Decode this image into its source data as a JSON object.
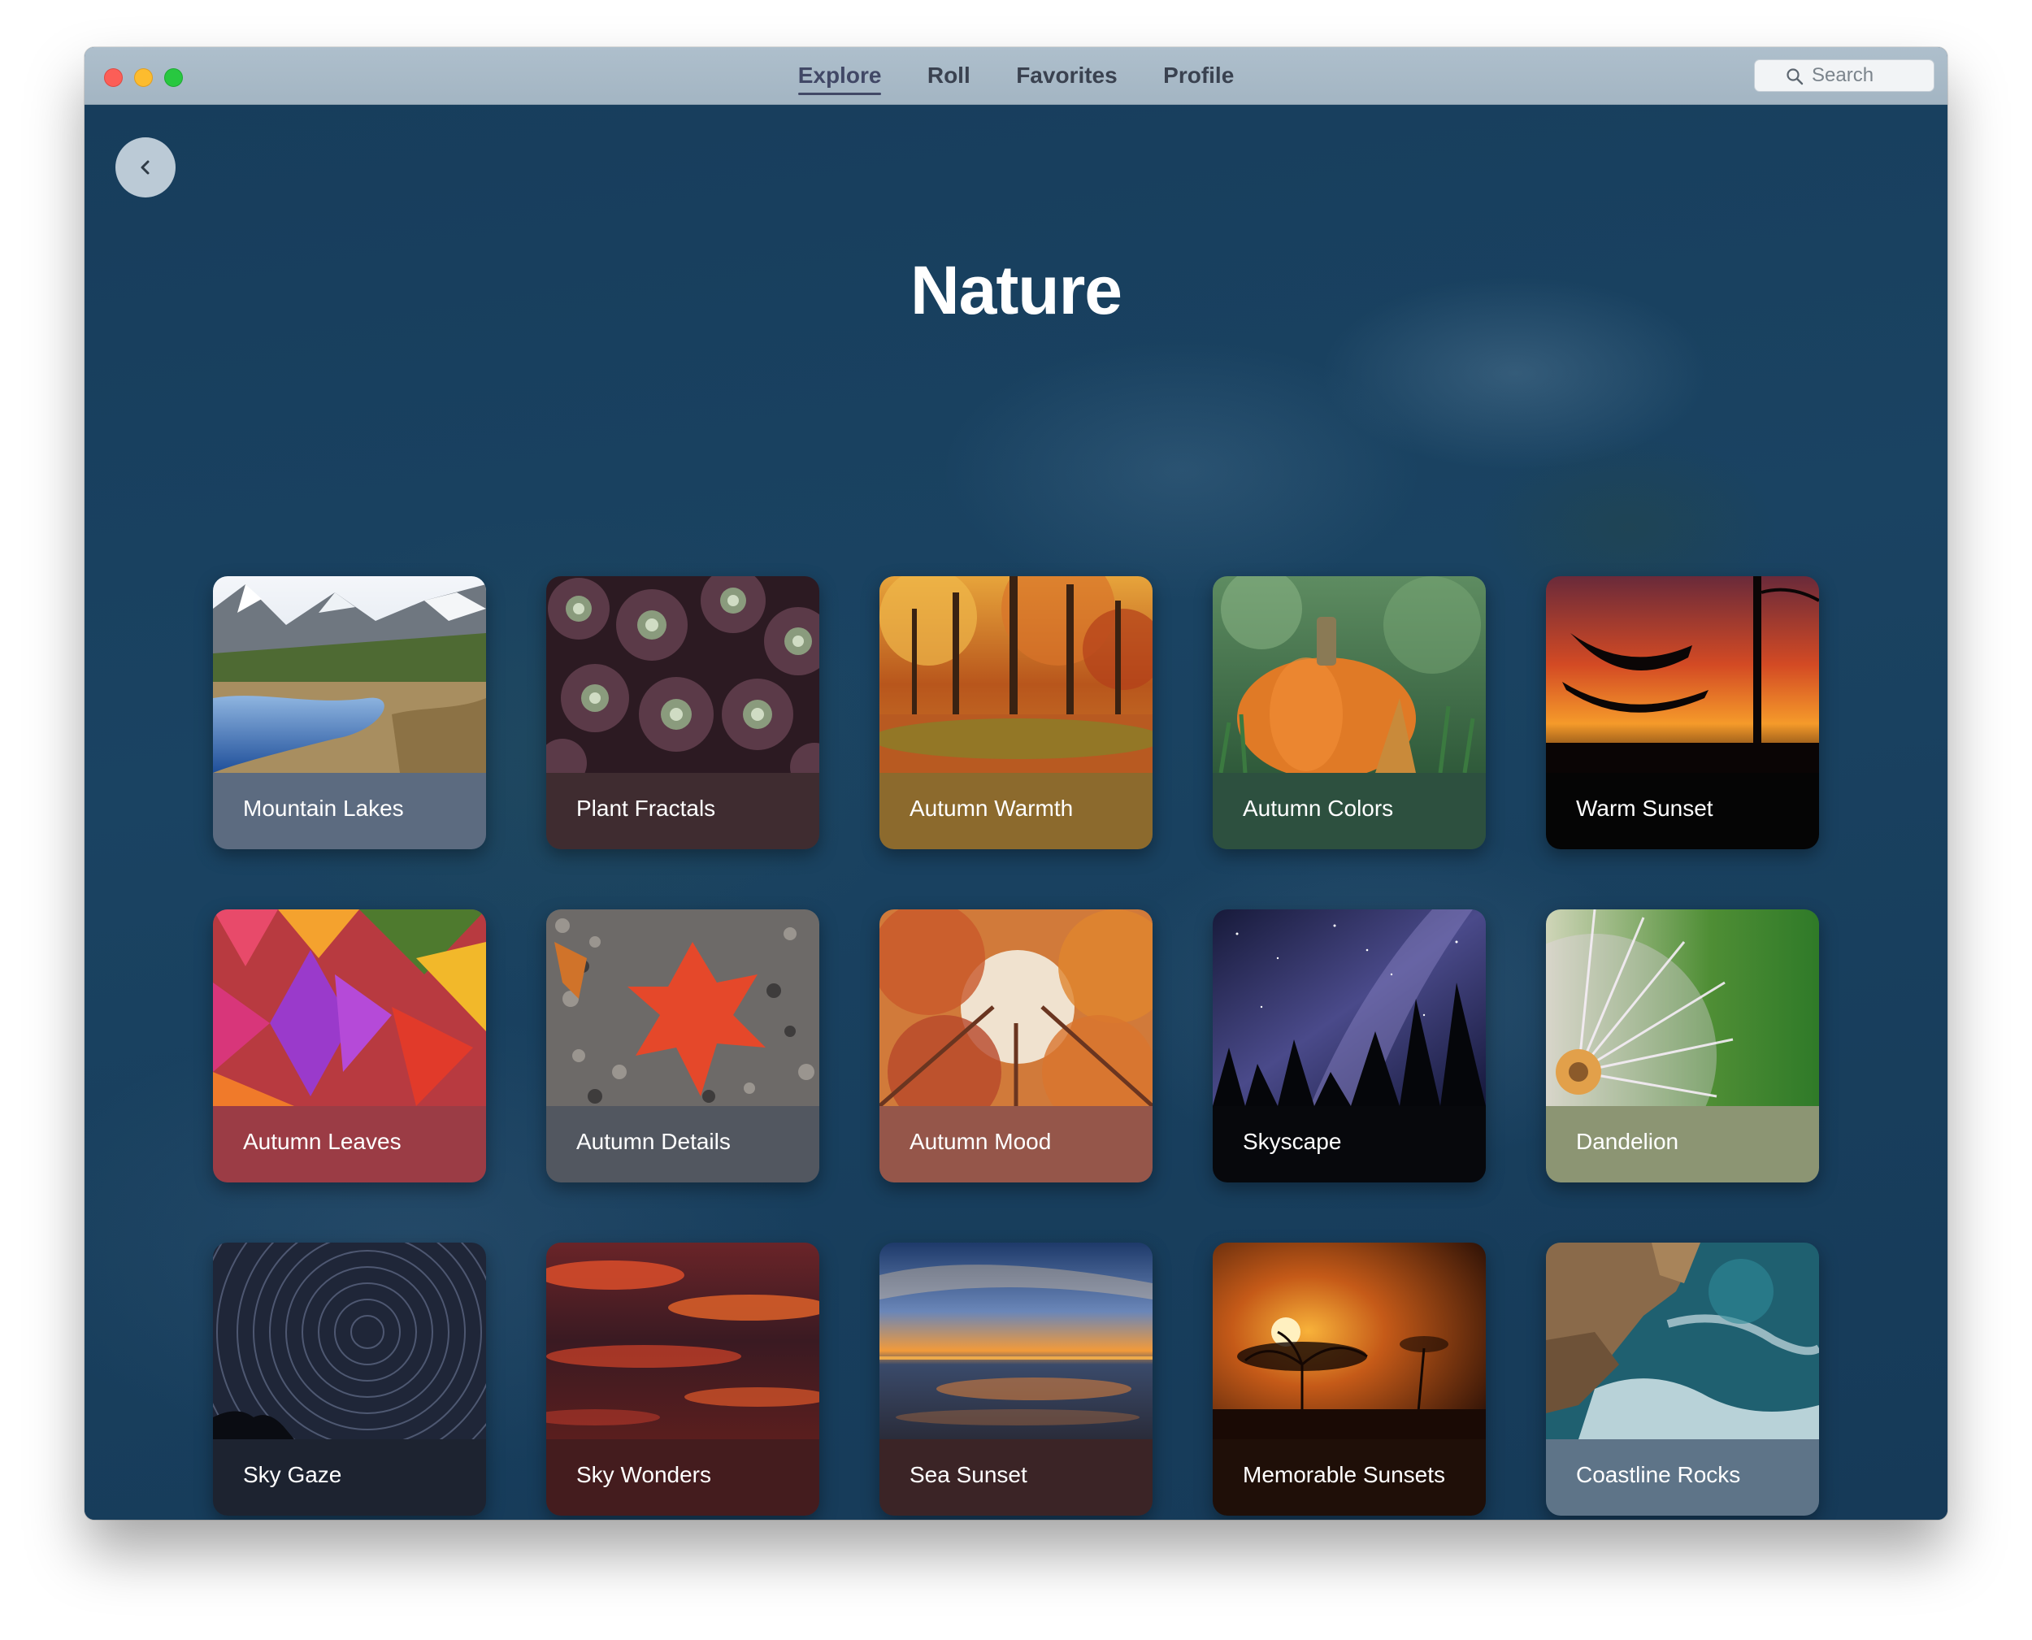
{
  "window": {
    "nav_tabs": [
      {
        "label": "Explore",
        "active": true
      },
      {
        "label": "Roll",
        "active": false
      },
      {
        "label": "Favorites",
        "active": false
      },
      {
        "label": "Profile",
        "active": false
      }
    ],
    "search": {
      "placeholder": "Search",
      "icon": "search-icon"
    },
    "back_icon": "chevron-left-icon"
  },
  "page": {
    "title": "Nature"
  },
  "cards": [
    {
      "title": "Mountain Lakes",
      "band_color": "#5c6b80"
    },
    {
      "title": "Plant Fractals",
      "band_color": "#3f2c30"
    },
    {
      "title": "Autumn Warmth",
      "band_color": "#8c6a2d"
    },
    {
      "title": "Autumn Colors",
      "band_color": "#2d503f"
    },
    {
      "title": "Warm Sunset",
      "band_color": "#050505"
    },
    {
      "title": "Autumn Leaves",
      "band_color": "#9b3c45"
    },
    {
      "title": "Autumn Details",
      "band_color": "#525760"
    },
    {
      "title": "Autumn Mood",
      "band_color": "#95564a"
    },
    {
      "title": "Skyscape",
      "band_color": "#07080c"
    },
    {
      "title": "Dandelion",
      "band_color": "#8c9573"
    },
    {
      "title": "Sky Gaze",
      "band_color": "#1d2330"
    },
    {
      "title": "Sky Wonders",
      "band_color": "#441c1e"
    },
    {
      "title": "Sea Sunset",
      "band_color": "#3b2426"
    },
    {
      "title": "Memorable Sunsets",
      "band_color": "#1f0f08"
    },
    {
      "title": "Coastline Rocks",
      "band_color": "#5e7488"
    }
  ]
}
